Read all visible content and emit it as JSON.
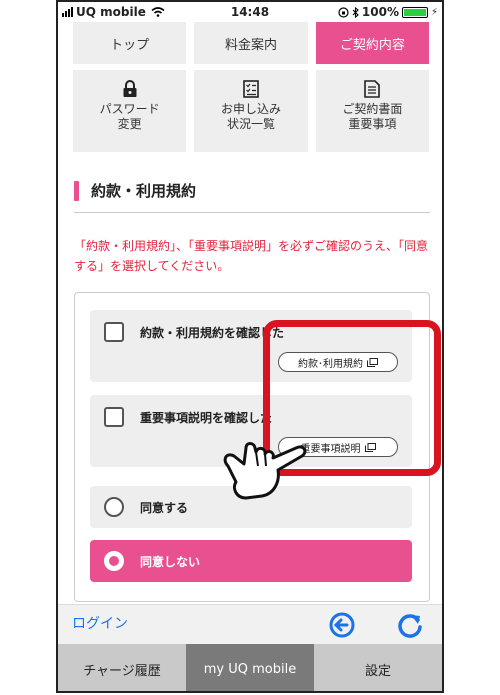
{
  "status_bar": {
    "carrier": "UQ mobile",
    "time": "14:48",
    "battery": "100%"
  },
  "top_nav": {
    "items": [
      "トップ",
      "料金案内",
      "ご契約内容"
    ],
    "active": "ご契約内容"
  },
  "icon_tiles": [
    {
      "icon": "lock-icon",
      "label": "パスワード\n変更"
    },
    {
      "icon": "checklist-icon",
      "label": "お申し込み\n状況一覧"
    },
    {
      "icon": "document-icon",
      "label": "ご契約書面\n重要事項"
    }
  ],
  "section": {
    "title": "約款・利用規約"
  },
  "notice": "「約款・利用規約」、「重要事項説明」を必ずご確認のうえ、「同意する」を選択してください。",
  "agreements": [
    {
      "label": "約款・利用規約を確認した",
      "link": "約款･利用規約"
    },
    {
      "label": "重要事項説明を確認した",
      "link": "重要事項説明"
    }
  ],
  "radios": {
    "agree": "同意する",
    "disagree": "同意しない"
  },
  "footer": {
    "login": "ログイン"
  },
  "tabbar": {
    "items": [
      "チャージ履歴",
      "my UQ mobile",
      "設定"
    ],
    "active": "my UQ mobile"
  },
  "colors": {
    "accent": "#e8508f",
    "highlight": "#d7141f",
    "link_blue": "#1a73e8"
  }
}
